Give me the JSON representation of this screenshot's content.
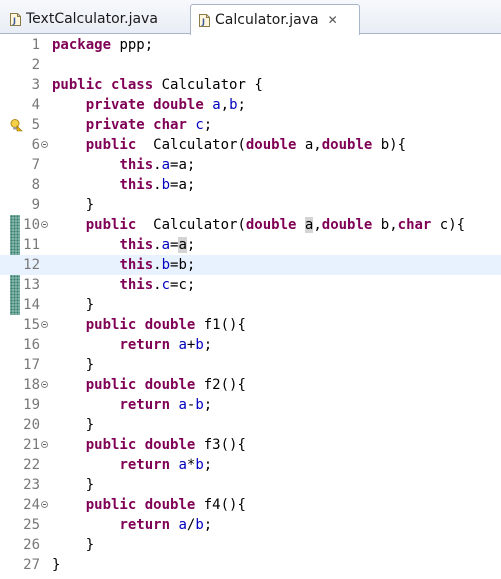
{
  "tabs": [
    {
      "label": "TextCalculator.java",
      "active": false,
      "icon": "java-file-icon"
    },
    {
      "label": "Calculator.java",
      "active": true,
      "icon": "java-file-icon",
      "close": "✕"
    }
  ],
  "colors": {
    "keyword": "#7f0055",
    "field": "#0000c0",
    "line_number": "#787878",
    "current_line": "#e8f2fe",
    "change_bar": "#7fb3a8"
  },
  "editor": {
    "current_line": 12,
    "warning_line": 5,
    "lines": [
      {
        "n": "1",
        "tokens": [
          [
            "kw",
            "package"
          ],
          [
            "plain",
            " ppp;"
          ]
        ]
      },
      {
        "n": "2",
        "tokens": []
      },
      {
        "n": "3",
        "tokens": [
          [
            "kw",
            "public"
          ],
          [
            "plain",
            " "
          ],
          [
            "kw",
            "class"
          ],
          [
            "plain",
            " Calculator {"
          ]
        ]
      },
      {
        "n": "4",
        "tokens": [
          [
            "plain",
            "    "
          ],
          [
            "kw",
            "private"
          ],
          [
            "plain",
            " "
          ],
          [
            "kw",
            "double"
          ],
          [
            "plain",
            " "
          ],
          [
            "fld",
            "a"
          ],
          [
            "plain",
            ","
          ],
          [
            "fld",
            "b"
          ],
          [
            "plain",
            ";"
          ]
        ]
      },
      {
        "n": "5",
        "tokens": [
          [
            "plain",
            "    "
          ],
          [
            "kw",
            "private"
          ],
          [
            "plain",
            " "
          ],
          [
            "kw",
            "char"
          ],
          [
            "plain",
            " "
          ],
          [
            "fld",
            "c"
          ],
          [
            "plain",
            ";"
          ]
        ]
      },
      {
        "n": "6",
        "fold": true,
        "tokens": [
          [
            "plain",
            "    "
          ],
          [
            "kw",
            "public"
          ],
          [
            "plain",
            "  Calculator("
          ],
          [
            "kw",
            "double"
          ],
          [
            "plain",
            " a,"
          ],
          [
            "kw",
            "double"
          ],
          [
            "plain",
            " b){"
          ]
        ]
      },
      {
        "n": "7",
        "tokens": [
          [
            "plain",
            "        "
          ],
          [
            "kw",
            "this"
          ],
          [
            "plain",
            "."
          ],
          [
            "fld",
            "a"
          ],
          [
            "plain",
            "=a;"
          ]
        ]
      },
      {
        "n": "8",
        "tokens": [
          [
            "plain",
            "        "
          ],
          [
            "kw",
            "this"
          ],
          [
            "plain",
            "."
          ],
          [
            "fld",
            "b"
          ],
          [
            "plain",
            "=a;"
          ]
        ]
      },
      {
        "n": "9",
        "tokens": [
          [
            "plain",
            "    }"
          ]
        ]
      },
      {
        "n": "10",
        "fold": true,
        "tokens": [
          [
            "plain",
            "    "
          ],
          [
            "kw",
            "public"
          ],
          [
            "plain",
            "  Calculator("
          ],
          [
            "kw",
            "double"
          ],
          [
            "plain",
            " "
          ],
          [
            "hl",
            "a"
          ],
          [
            "plain",
            ","
          ],
          [
            "kw",
            "double"
          ],
          [
            "plain",
            " b,"
          ],
          [
            "kw",
            "char"
          ],
          [
            "plain",
            " c){"
          ]
        ]
      },
      {
        "n": "11",
        "tokens": [
          [
            "plain",
            "        "
          ],
          [
            "kw",
            "this"
          ],
          [
            "plain",
            "."
          ],
          [
            "fld",
            "a"
          ],
          [
            "plain",
            "="
          ],
          [
            "hl",
            "a"
          ],
          [
            "plain",
            ";"
          ]
        ]
      },
      {
        "n": "12",
        "tokens": [
          [
            "plain",
            "        "
          ],
          [
            "kw",
            "this"
          ],
          [
            "plain",
            "."
          ],
          [
            "fld",
            "b"
          ],
          [
            "plain",
            "=b;"
          ]
        ]
      },
      {
        "n": "13",
        "tokens": [
          [
            "plain",
            "        "
          ],
          [
            "kw",
            "this"
          ],
          [
            "plain",
            "."
          ],
          [
            "fld",
            "c"
          ],
          [
            "plain",
            "=c;"
          ]
        ]
      },
      {
        "n": "14",
        "tokens": [
          [
            "plain",
            "    }"
          ]
        ]
      },
      {
        "n": "15",
        "fold": true,
        "tokens": [
          [
            "plain",
            "    "
          ],
          [
            "kw",
            "public"
          ],
          [
            "plain",
            " "
          ],
          [
            "kw",
            "double"
          ],
          [
            "plain",
            " f1(){"
          ]
        ]
      },
      {
        "n": "16",
        "tokens": [
          [
            "plain",
            "        "
          ],
          [
            "kw",
            "return"
          ],
          [
            "plain",
            " "
          ],
          [
            "fld",
            "a"
          ],
          [
            "plain",
            "+"
          ],
          [
            "fld",
            "b"
          ],
          [
            "plain",
            ";"
          ]
        ]
      },
      {
        "n": "17",
        "tokens": [
          [
            "plain",
            "    }"
          ]
        ]
      },
      {
        "n": "18",
        "fold": true,
        "tokens": [
          [
            "plain",
            "    "
          ],
          [
            "kw",
            "public"
          ],
          [
            "plain",
            " "
          ],
          [
            "kw",
            "double"
          ],
          [
            "plain",
            " f2(){"
          ]
        ]
      },
      {
        "n": "19",
        "tokens": [
          [
            "plain",
            "        "
          ],
          [
            "kw",
            "return"
          ],
          [
            "plain",
            " "
          ],
          [
            "fld",
            "a"
          ],
          [
            "plain",
            "-"
          ],
          [
            "fld",
            "b"
          ],
          [
            "plain",
            ";"
          ]
        ]
      },
      {
        "n": "20",
        "tokens": [
          [
            "plain",
            "    }"
          ]
        ]
      },
      {
        "n": "21",
        "fold": true,
        "tokens": [
          [
            "plain",
            "    "
          ],
          [
            "kw",
            "public"
          ],
          [
            "plain",
            " "
          ],
          [
            "kw",
            "double"
          ],
          [
            "plain",
            " f3(){"
          ]
        ]
      },
      {
        "n": "22",
        "tokens": [
          [
            "plain",
            "        "
          ],
          [
            "kw",
            "return"
          ],
          [
            "plain",
            " "
          ],
          [
            "fld",
            "a"
          ],
          [
            "plain",
            "*"
          ],
          [
            "fld",
            "b"
          ],
          [
            "plain",
            ";"
          ]
        ]
      },
      {
        "n": "23",
        "tokens": [
          [
            "plain",
            "    }"
          ]
        ]
      },
      {
        "n": "24",
        "fold": true,
        "tokens": [
          [
            "plain",
            "    "
          ],
          [
            "kw",
            "public"
          ],
          [
            "plain",
            " "
          ],
          [
            "kw",
            "double"
          ],
          [
            "plain",
            " f4(){"
          ]
        ]
      },
      {
        "n": "25",
        "tokens": [
          [
            "plain",
            "        "
          ],
          [
            "kw",
            "return"
          ],
          [
            "plain",
            " "
          ],
          [
            "fld",
            "a"
          ],
          [
            "plain",
            "/"
          ],
          [
            "fld",
            "b"
          ],
          [
            "plain",
            ";"
          ]
        ]
      },
      {
        "n": "26",
        "tokens": [
          [
            "plain",
            "    }"
          ]
        ]
      },
      {
        "n": "27",
        "tokens": [
          [
            "plain",
            "}"
          ]
        ]
      }
    ]
  }
}
